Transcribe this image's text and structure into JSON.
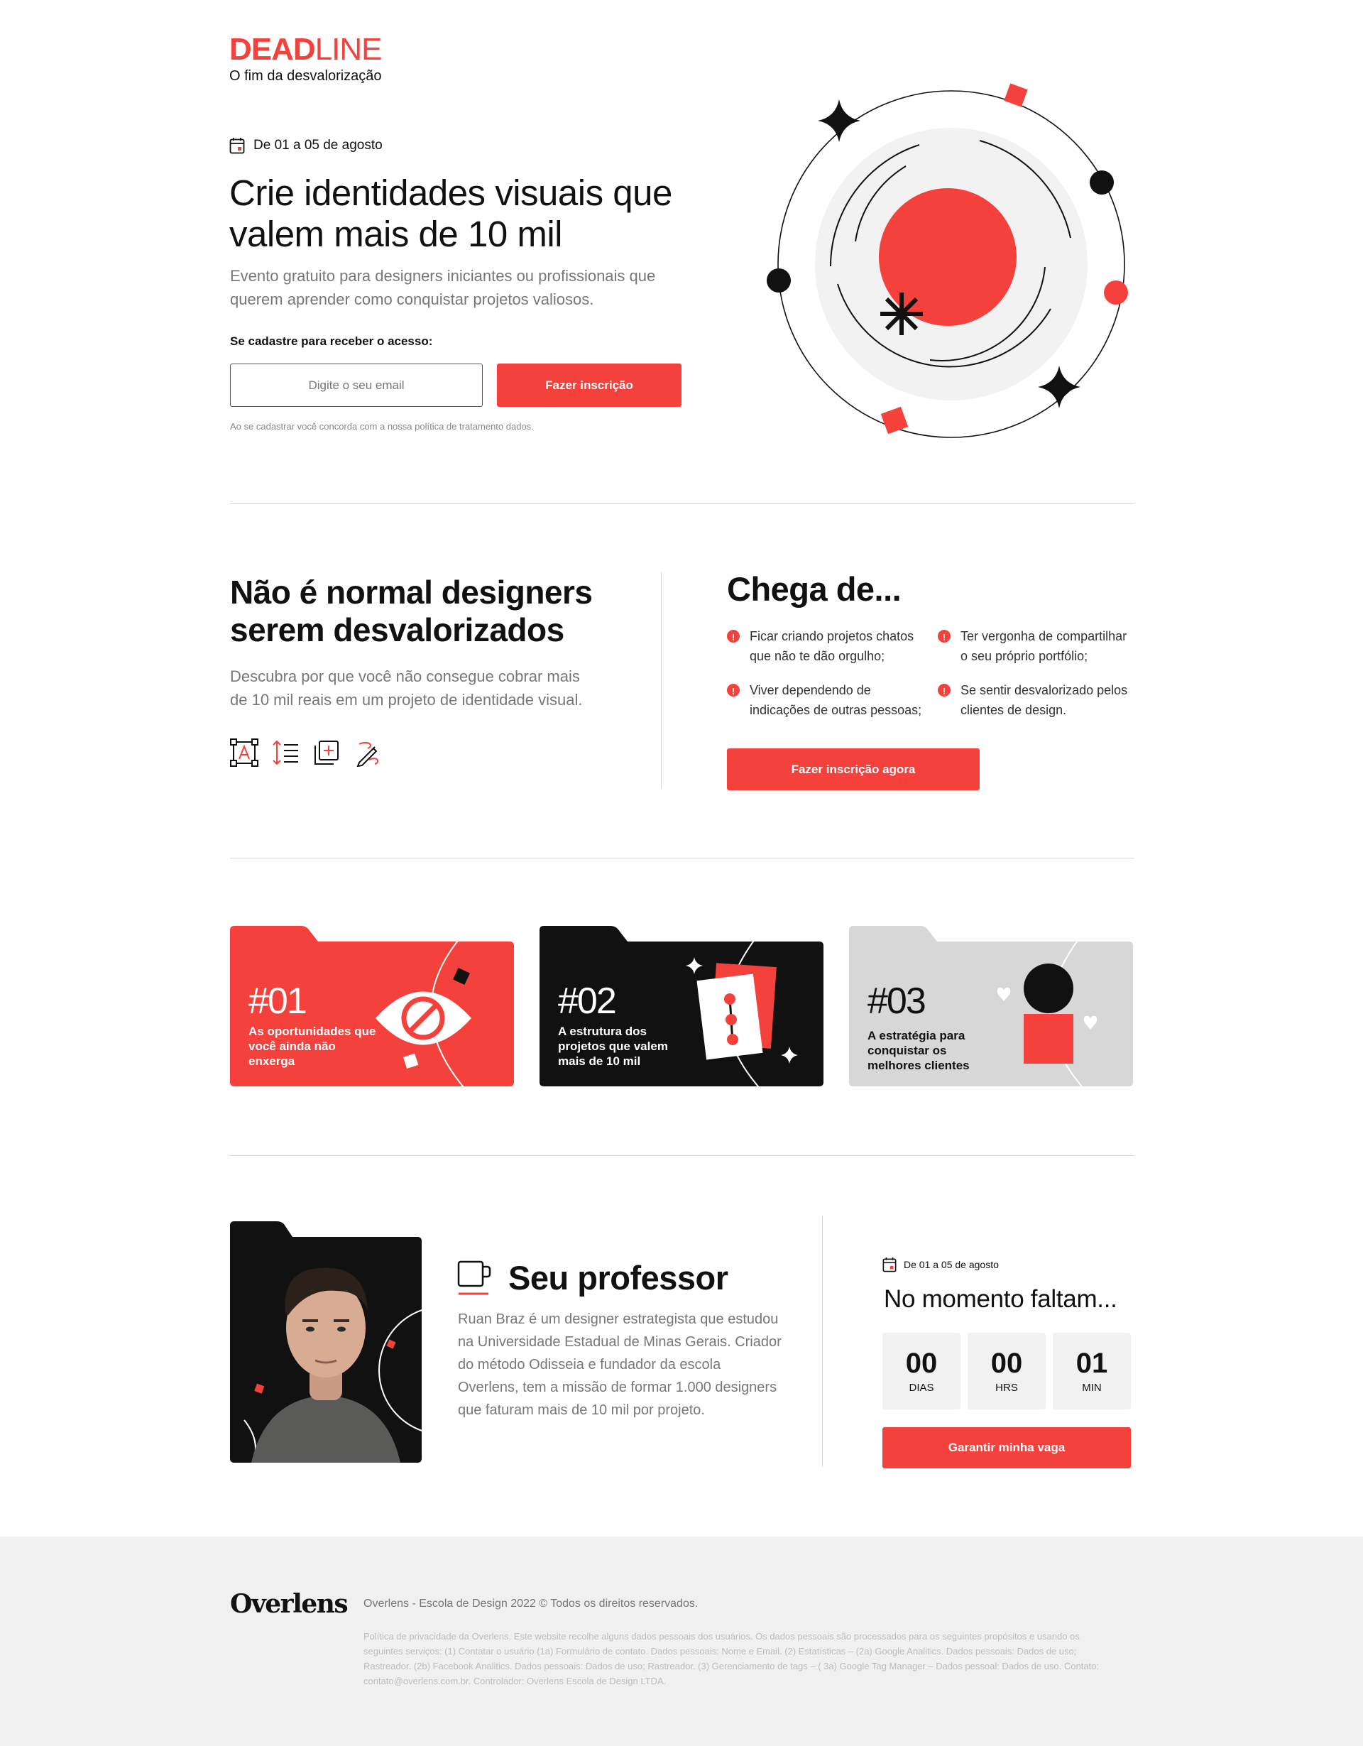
{
  "colors": {
    "accent": "#f5413c",
    "dark": "#111111",
    "muted": "#777777",
    "light": "#f1f1f1"
  },
  "brand": {
    "logo_bold": "DEAD",
    "logo_light": "LINE",
    "tagline": "O fim da desvalorização"
  },
  "hero": {
    "date": "De 01 a 05 de agosto",
    "title": "Crie identidades visuais que valem mais de 10 mil",
    "subtitle": "Evento gratuito para designers iniciantes ou profissionais que querem aprender como conquistar projetos valiosos.",
    "form_label": "Se cadastre para receber o acesso:",
    "email_placeholder": "Digite o seu email",
    "cta": "Fazer inscrição",
    "fine_print": "Ao se cadastrar você concorda com a nossa política de tratamento dados."
  },
  "problem": {
    "title": "Não é normal designers serem desvalorizados",
    "subtitle": "Descubra por que você não consegue cobrar mais de 10 mil reais em um projeto de identidade visual.",
    "tools": [
      "text-frame-icon",
      "line-height-icon",
      "add-layer-icon",
      "pen-tool-icon"
    ]
  },
  "enough": {
    "title": "Chega de...",
    "items": [
      "Ficar criando projetos chatos que não te dão orgulho;",
      "Ter vergonha de compartilhar o seu próprio portfólio;",
      "Viver dependendo de indicações de outras pessoas;",
      "Se sentir desvalorizado pelos clientes de design."
    ],
    "cta": "Fazer inscrição agora"
  },
  "cards": [
    {
      "num": "#01",
      "text": "As oportunidades que você ainda não enxerga",
      "theme": "red"
    },
    {
      "num": "#02",
      "text": "A estrutura dos projetos que valem mais de 10 mil",
      "theme": "black"
    },
    {
      "num": "#03",
      "text": "A estratégia para conquistar os melhores clientes",
      "theme": "gray"
    }
  ],
  "professor": {
    "title": "Seu professor",
    "bio": "Ruan Braz é um designer estrategista que estudou na Universidade Estadual de Minas Gerais. Criador do método Odisseia e fundador da escola Overlens, tem a missão de formar 1.000 designers que faturam mais de 10 mil por projeto."
  },
  "countdown": {
    "date": "De 01 a 05 de agosto",
    "title": "No momento faltam...",
    "units": [
      {
        "value": "00",
        "label": "DIAS"
      },
      {
        "value": "00",
        "label": "HRS"
      },
      {
        "value": "01",
        "label": "MIN"
      }
    ],
    "cta": "Garantir minha vaga"
  },
  "footer": {
    "logo": "Overlens",
    "copyright": "Overlens - Escola de Design 2022 © Todos os direitos reservados.",
    "privacy": "Política de privacidade da Overlens. Este website recolhe alguns dados pessoais dos usuários. Os dados pessoais são processados para os seguintes propósitos e usando os seguintes serviços: (1) Contatar o usuário (1a) Formulário de contato. Dados pessoais: Nome e Email. (2) Estatísticas – (2a) Google Analitics. Dados pessoais: Dados de uso; Rastreador. (2b) Facebook Analitics. Dados pessoais: Dados de uso; Rastreador. (3) Gerenciamento de tags – ( 3a) Google Tag Manager – Dados pessoal: Dados de uso. Contato: contato@overlens.com.br. Controlador: Overlens Escola de Design LTDA."
  }
}
